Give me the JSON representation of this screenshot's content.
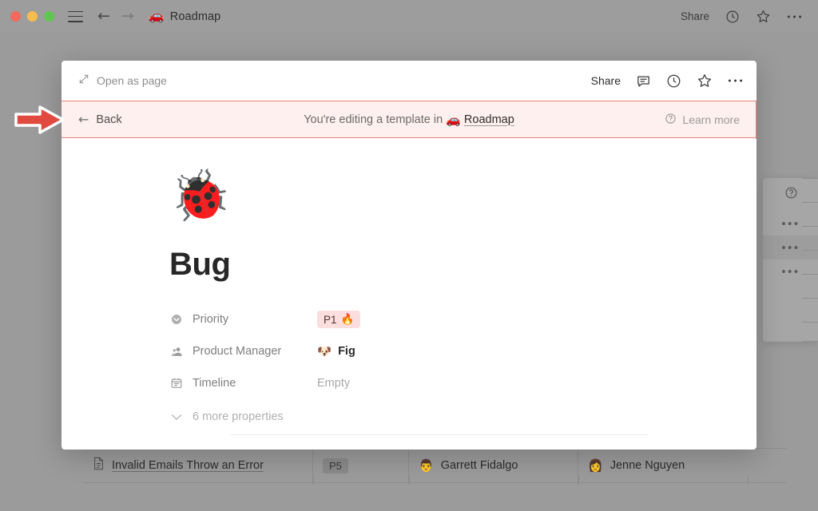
{
  "titlebar": {
    "doc_emoji": "🚗",
    "title": "Roadmap",
    "share_label": "Share",
    "icons": [
      "hamburger-icon",
      "back-arrow-icon",
      "forward-arrow-icon",
      "history-clock-icon",
      "favorite-star-icon",
      "more-options-icon"
    ],
    "back_arrow": "←",
    "forward_arrow": "→"
  },
  "modal": {
    "header": {
      "open_as_page_label": "Open as page",
      "share_label": "Share",
      "icons": [
        "expand-icon",
        "comment-icon",
        "history-clock-icon",
        "favorite-star-icon",
        "more-options-icon"
      ]
    },
    "template_banner": {
      "back_label": "Back",
      "message_prefix": "You're editing a template in",
      "database_emoji": "🚗",
      "database_name": "Roadmap",
      "learn_more_label": "Learn more",
      "border_color": "#e8837a",
      "background_color": "#fdf0ee"
    },
    "page": {
      "emoji": "🐞",
      "title": "Bug",
      "properties": [
        {
          "icon": "select-dropdown-icon",
          "label": "Priority",
          "value": "P1",
          "value_emoji": "🔥",
          "type": "chip",
          "chip_color": "#fbdedd"
        },
        {
          "icon": "person-icon",
          "label": "Product Manager",
          "value": "Fig",
          "value_emoji": "🐶",
          "type": "person"
        },
        {
          "icon": "date-icon",
          "label": "Timeline",
          "value": "Empty",
          "value_emoji": "",
          "type": "empty"
        }
      ],
      "more_properties_label": "6 more properties"
    }
  },
  "background": {
    "table_row": {
      "doc_icon": "document-icon",
      "name": "Invalid Emails Throw an Error",
      "priority": "P5",
      "person_one_emoji": "👨",
      "person_one": "Garrett Fidalgo",
      "person_two_emoji": "👩",
      "person_two": "Jenne Nguyen"
    },
    "side_panel": {
      "help_icon": "help-circle-icon",
      "menu_rows": [
        "more-options-icon",
        "more-options-icon",
        "more-options-icon"
      ],
      "dots": "•••"
    }
  },
  "annotation": {
    "arrow_color": "#e04a3f",
    "arrow_name": "pointer-arrow"
  }
}
